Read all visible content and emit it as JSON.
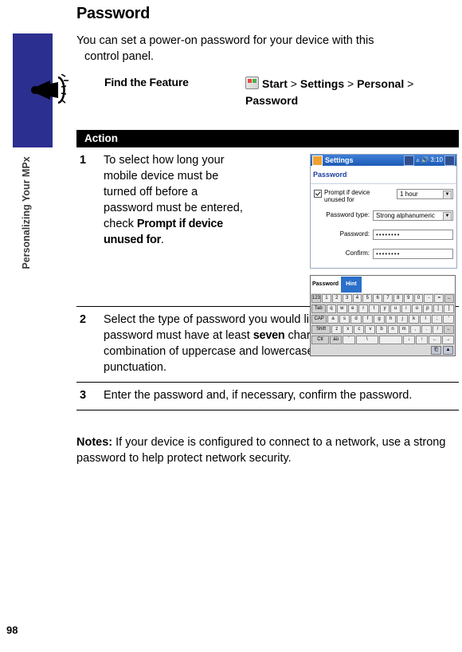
{
  "page": {
    "number": "98",
    "side_label": "Personalizing Your MPx",
    "title": "Password",
    "intro_line1": "You can set a power-on password for your device with this",
    "intro_line2": "control panel."
  },
  "find_feature": {
    "label": "Find the Feature",
    "start_icon": "windows-start-icon",
    "start": "Start",
    "sep1": ">",
    "settings": "Settings",
    "sep2": ">",
    "personal": "Personal",
    "sep3": ">",
    "password": "Password"
  },
  "table": {
    "header": "Action",
    "rows": [
      {
        "num": "1",
        "text_a": "To select how long your mobile device must be turned off before a password must be entered, check ",
        "text_b": "Prompt if device unused for",
        "text_c": "."
      },
      {
        "num": "2",
        "text_a": "Select the type of password you would like to use. A strong password must have at least ",
        "text_b": "seven",
        "text_c": " characters that are a combination of uppercase and lowercase letters, numerals, and punctuation."
      },
      {
        "num": "3",
        "text_a": "Enter the password and, if necessary, confirm the password.",
        "text_b": "",
        "text_c": ""
      }
    ]
  },
  "device": {
    "titlebar": {
      "title": "Settings",
      "time": "3:10",
      "icons": [
        "keyboard-icon",
        "antenna-icon",
        "speaker-icon",
        "ok-icon"
      ]
    },
    "subtitle": "Password",
    "checkbox_label": "Prompt if device unused for",
    "checkbox_value": "1 hour",
    "fields": [
      {
        "label": "Password type:",
        "value": "Strong alphanumeric",
        "is_combo": true
      },
      {
        "label": "Password:",
        "value": "••••••••",
        "is_combo": false
      },
      {
        "label": "Confirm:",
        "value": "••••••••",
        "is_combo": false
      }
    ],
    "keyboard": {
      "tabs": [
        "Password",
        "Hint"
      ],
      "rows": [
        [
          "123",
          "1",
          "2",
          "3",
          "4",
          "5",
          "6",
          "7",
          "8",
          "9",
          "0",
          "-",
          "=",
          "←"
        ],
        [
          "Tab",
          "q",
          "w",
          "e",
          "r",
          "t",
          "y",
          "u",
          "i",
          "o",
          "p",
          "[",
          "]"
        ],
        [
          "CAP",
          "a",
          "s",
          "d",
          "f",
          "g",
          "h",
          "j",
          "k",
          "l",
          ";",
          "'"
        ],
        [
          "Shift",
          "z",
          "x",
          "c",
          "v",
          "b",
          "n",
          "m",
          ",",
          ".",
          "/",
          "←"
        ],
        [
          "Ctl",
          "áü",
          "`",
          "\\",
          "",
          "↓",
          "↑",
          "←",
          "→"
        ]
      ],
      "bottom_keys": [
        "keyboard-icon",
        "arrow-up-icon"
      ]
    }
  },
  "notes": {
    "label": "Notes:",
    "text": " If your device is configured to connect to a network, use a strong password to help protect network security."
  }
}
